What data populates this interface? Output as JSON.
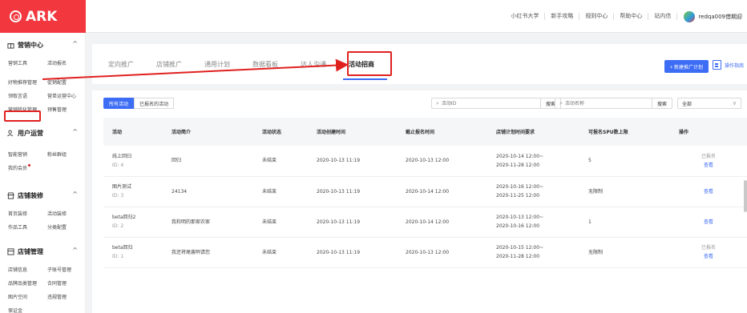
{
  "brand": {
    "logo_text": "ARK",
    "accent": "#f2373f",
    "primary": "#3d6cf5",
    "highlight": "#e0201f"
  },
  "topnav": {
    "links": [
      "小红书大学",
      "新手攻略",
      "规则中心",
      "帮助中心",
      "站内信"
    ],
    "username": "redqa009借期迎"
  },
  "sidebar": {
    "sections": [
      {
        "title": "营销中心",
        "icon": "gift-icon",
        "items": [
          "营销工具",
          "活动报名",
          "好物推荐管理",
          "促销配置",
          "领取言语",
          "营单运营中心",
          "营销转化管理",
          "预售管理"
        ]
      },
      {
        "title": "用户运营",
        "icon": "users-icon",
        "items": [
          "智能营销",
          "粉丝群组",
          "我的会员"
        ]
      },
      {
        "title": "店铺装修",
        "icon": "shop-icon",
        "items": [
          "首页装修",
          "活动装修",
          "作品工具",
          "分类配置"
        ]
      },
      {
        "title": "店铺管理",
        "icon": "store-icon",
        "items": [
          "店铺信息",
          "子账号管理",
          "品牌品类管理",
          "合同管理",
          "图片空间",
          "违规管理",
          "保证金"
        ]
      }
    ]
  },
  "tabs": [
    "定向推广",
    "店铺推广",
    "通用计划",
    "数据看板",
    "达人沟通",
    "活动招商"
  ],
  "active_tab": "活动招商",
  "new_plan_button": "+ 新建推广计划",
  "guide_label": "操作指南",
  "filters": [
    "所有活动",
    "已报名的活动"
  ],
  "search1": {
    "placeholder": "活动ID",
    "button": "搜索"
  },
  "search2": {
    "placeholder": "活动名称",
    "button": "搜索"
  },
  "status_select": "全部",
  "table": {
    "headers": [
      "活动",
      "活动简介",
      "活动状态",
      "活动创建时间",
      "截止报名时间",
      "店铺计划时间要求",
      "可报名SPU数上限",
      "操作"
    ],
    "rows": [
      {
        "name": "线上回归",
        "id": "ID: 4",
        "desc": "回归",
        "status": "未结束",
        "created": "2020-10-13 11:19",
        "deadline": "2020-10-13 12:00",
        "time1": "2020-10-14 12:00~",
        "time2": "2020-11-28 12:00",
        "limit": "5",
        "op_status": "已报名",
        "op_link": "查看"
      },
      {
        "name": "图片测试",
        "id": "ID: 3",
        "desc": "24134",
        "status": "未结束",
        "created": "2020-10-13 11:19",
        "deadline": "2020-10-14 12:00",
        "time1": "2020-10-16 12:00~",
        "time2": "2020-11-25 12:00",
        "limit": "无限制",
        "op_status": "",
        "op_link": "查看"
      },
      {
        "name": "beta回归2",
        "id": "ID: 2",
        "desc": "我和明的那家农家",
        "status": "未结束",
        "created": "2020-10-13 11:19",
        "deadline": "2020-10-14 12:00",
        "time1": "2020-10-13 12:00~",
        "time2": "2020-10-16 12:00",
        "limit": "1",
        "op_status": "",
        "op_link": "查看"
      },
      {
        "name": "beta回归",
        "id": "ID: 1",
        "desc": "我还将尾酱咧请您",
        "status": "未结束",
        "created": "2020-10-13 11:19",
        "deadline": "2020-10-13 12:00",
        "time1": "2020-10-15 12:00~",
        "time2": "2020-11-28 12:00",
        "limit": "无限制",
        "op_status": "已报名",
        "op_link": "查看"
      }
    ]
  }
}
